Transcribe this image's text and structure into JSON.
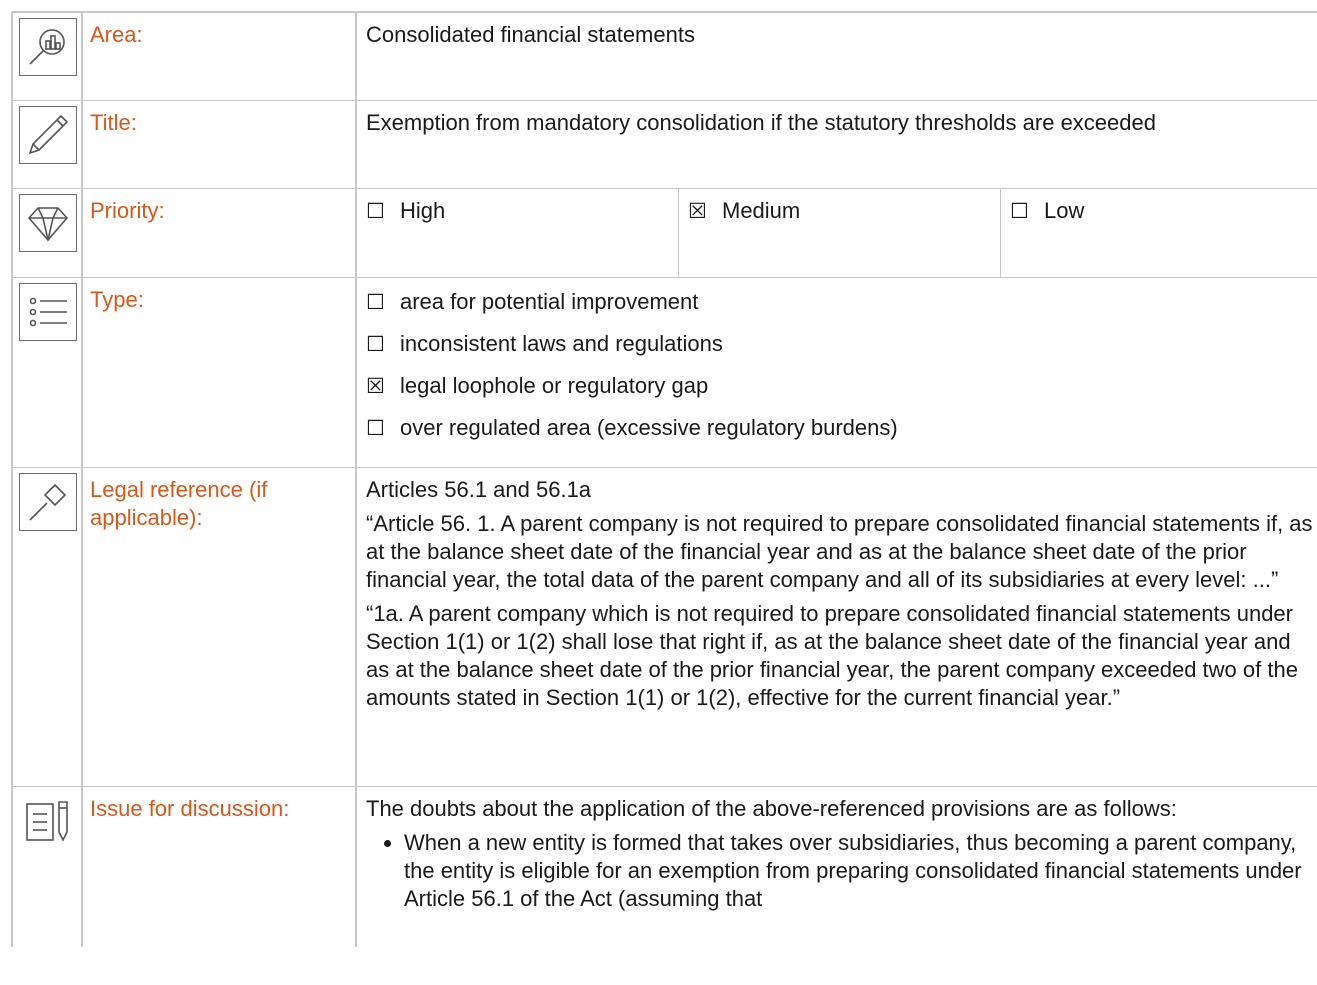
{
  "rows": {
    "area": {
      "label": "Area:",
      "value": "Consolidated financial statements",
      "icon": "magnifier-chart-icon"
    },
    "title": {
      "label": "Title:",
      "value": "Exemption from mandatory consolidation if the statutory thresholds are exceeded",
      "icon": "pencil-icon"
    },
    "priority": {
      "label": "Priority:",
      "icon": "diamond-icon",
      "options": [
        {
          "mark": "☐",
          "label": "High"
        },
        {
          "mark": "☒",
          "label": "Medium"
        },
        {
          "mark": "☐",
          "label": "Low"
        }
      ]
    },
    "type": {
      "label": "Type:",
      "icon": "list-icon",
      "options": [
        {
          "mark": "☐",
          "label": "area for potential improvement"
        },
        {
          "mark": "☐",
          "label": "inconsistent laws and regulations"
        },
        {
          "mark": "☒",
          "label": "legal loophole or regulatory gap"
        },
        {
          "mark": "☐",
          "label": "over regulated area (excessive regulatory burdens)"
        }
      ]
    },
    "legal": {
      "label": "Legal reference (if applicable):",
      "icon": "gavel-icon",
      "paragraphs": [
        "Articles 56.1 and 56.1a",
        "“Article 56. 1. A parent company is not required to prepare consolidated financial statements if, as at the balance sheet date of the financial year and as at the balance sheet date of the prior financial year, the total data of the parent company and all of its subsidiaries at every level: ...”",
        "“1a. A parent company which is not required to prepare consolidated financial statements under Section 1(1) or 1(2) shall lose that right if, as at the balance sheet date of the financial year and as at the balance sheet date of the prior financial year, the parent company exceeded two of the amounts stated in Section 1(1) or 1(2), effective for the current financial year.”"
      ]
    },
    "issue": {
      "label": "Issue for discussion:",
      "icon": "document-pen-icon",
      "intro": "The doubts about the application of the above-referenced provisions are as follows:",
      "bullets": [
        "When a new entity is formed that takes over subsidiaries, thus becoming a parent company, the entity is eligible for an exemption from preparing consolidated financial statements under Article 56.1 of the Act (assuming that"
      ]
    }
  }
}
